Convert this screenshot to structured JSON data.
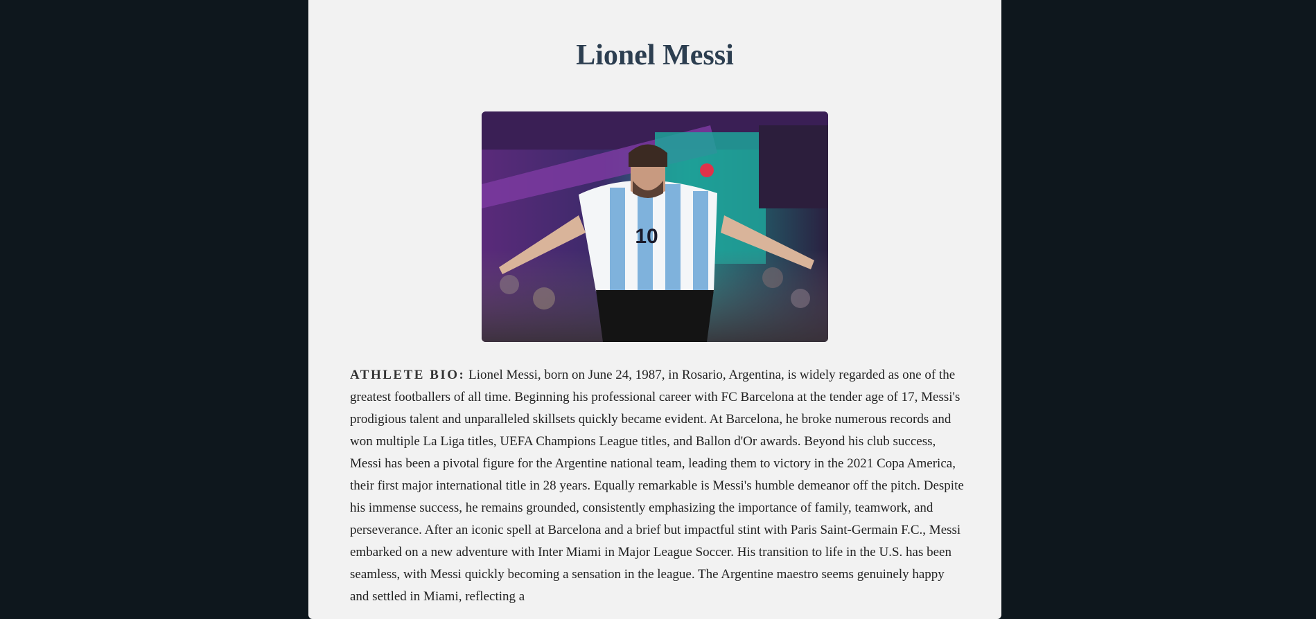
{
  "page": {
    "title": "Lionel Messi",
    "bio_label": "ATHLETE BIO:",
    "bio_text": "Lionel Messi, born on June 24, 1987, in Rosario, Argentina, is widely regarded as one of the greatest footballers of all time. Beginning his professional career with FC Barcelona at the tender age of 17, Messi's prodigious talent and unparalleled skillsets quickly became evident. At Barcelona, he broke numerous records and won multiple La Liga titles, UEFA Champions League titles, and Ballon d'Or awards. Beyond his club success, Messi has been a pivotal figure for the Argentine national team, leading them to victory in the 2021 Copa America, their first major international title in 28 years. Equally remarkable is Messi's humble demeanor off the pitch. Despite his immense success, he remains grounded, consistently emphasizing the importance of family, teamwork, and perseverance. After an iconic spell at Barcelona and a brief but impactful stint with Paris Saint-Germain F.C., Messi embarked on a new adventure with Inter Miami in Major League Soccer. His transition to life in the U.S. has been seamless, with Messi quickly becoming a sensation in the league. The Argentine maestro seems genuinely happy and settled in Miami, reflecting a"
  },
  "photo": {
    "jersey_number": "10"
  },
  "colors": {
    "page_background": "#0e171d",
    "card_background": "#f2f2f2",
    "title_color": "#2c3e50"
  }
}
